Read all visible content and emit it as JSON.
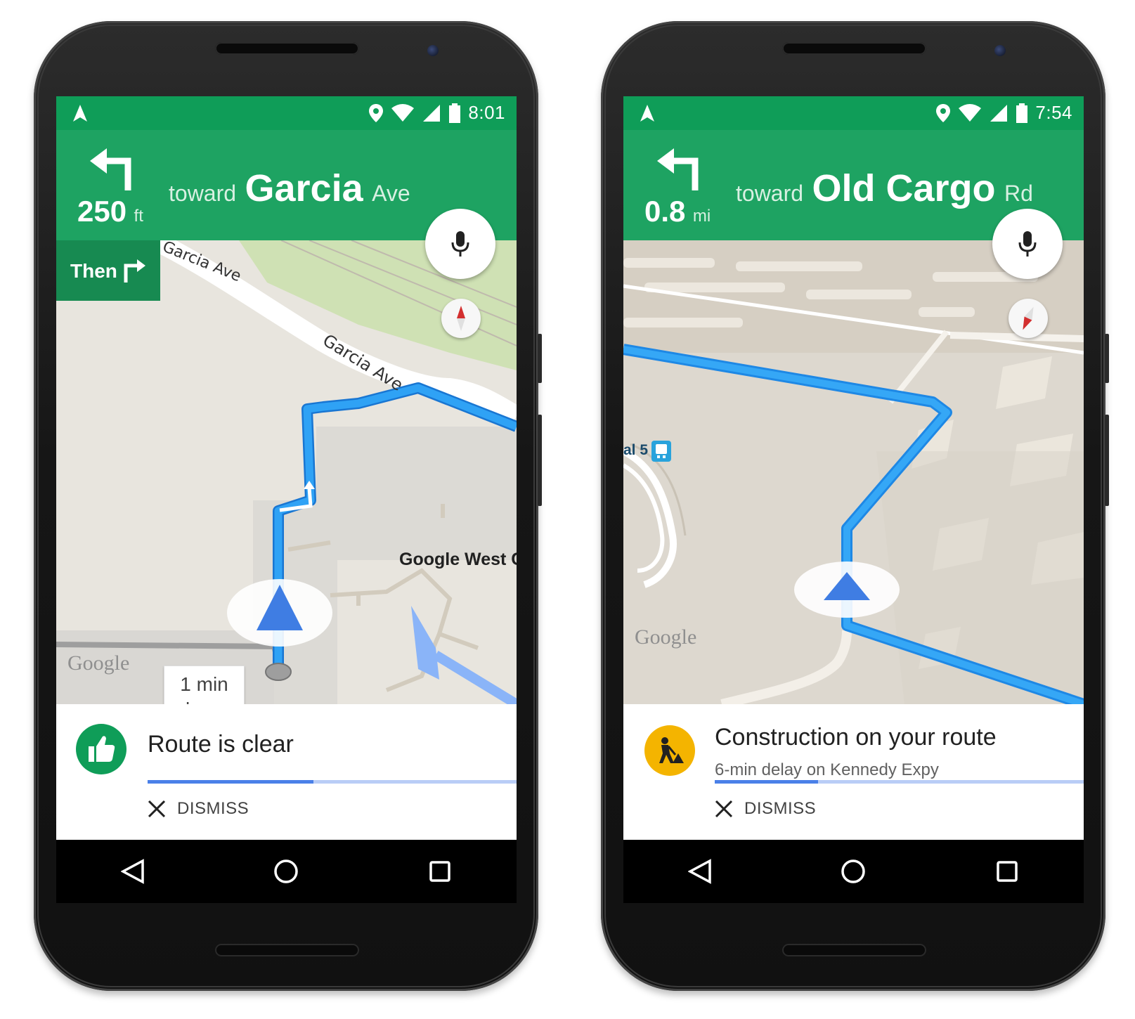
{
  "phones": [
    {
      "status": {
        "time": "8:01"
      },
      "instruction": {
        "distance_value": "250",
        "distance_unit": "ft",
        "toward": "toward",
        "street": "Garcia",
        "suffix": "Ave"
      },
      "then": {
        "label": "Then"
      },
      "map": {
        "street_labels": [
          "Garcia Ave",
          "Garcia Ave"
        ],
        "place_label": "Google West C",
        "bubble_line1": "1 min",
        "bubble_line2": "slower",
        "google_mark": "Google"
      },
      "alert": {
        "icon": "thumbs-up-icon",
        "icon_color": "#0f9d58",
        "title": "Route is clear",
        "subtitle": "",
        "progress": 0.45,
        "dismiss_label": "DISMISS"
      }
    },
    {
      "status": {
        "time": "7:54"
      },
      "instruction": {
        "distance_value": "0.8",
        "distance_unit": "mi",
        "toward": "toward",
        "street": "Old Cargo",
        "suffix": "Rd"
      },
      "map": {
        "transit_label": "al 5",
        "google_mark": "Google"
      },
      "alert": {
        "icon": "construction-worker-icon",
        "icon_color": "#f4b400",
        "title": "Construction on your route",
        "subtitle": "6-min delay on Kennedy Expy",
        "progress": 0.28,
        "dismiss_label": "DISMISS"
      }
    }
  ],
  "colors": {
    "nav_green": "#1ea362",
    "status_green": "#0f9d58",
    "route_blue": "#2196f3",
    "arrow_blue": "#3f7de3"
  }
}
